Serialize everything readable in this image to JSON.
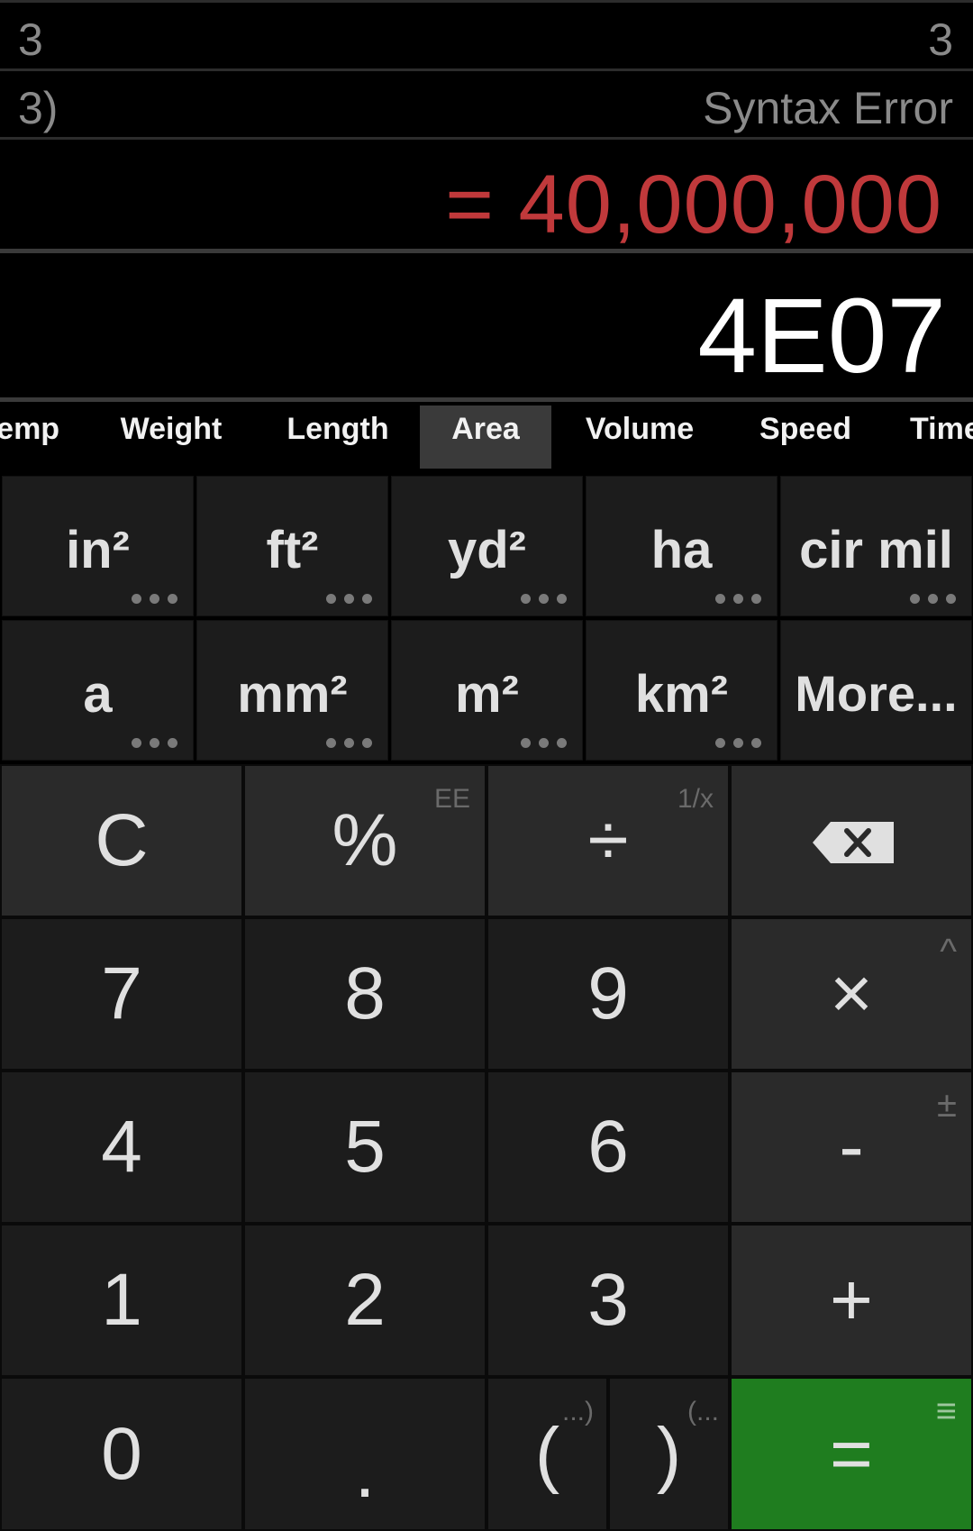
{
  "history": [
    {
      "expression": "3",
      "result": "3"
    },
    {
      "expression": "3)",
      "result": "Syntax Error"
    }
  ],
  "result_display": "= 40,000,000",
  "expression_display": "4E07",
  "colors": {
    "result": "#c0393b",
    "equals_key": "#1f7d1f",
    "active_tab": "#3a3a3a"
  },
  "tabs": [
    {
      "label": "Temp",
      "active": false
    },
    {
      "label": "Weight",
      "active": false
    },
    {
      "label": "Length",
      "active": false
    },
    {
      "label": "Area",
      "active": true
    },
    {
      "label": "Volume",
      "active": false
    },
    {
      "label": "Speed",
      "active": false
    },
    {
      "label": "Time",
      "active": false
    }
  ],
  "units": [
    {
      "label": "in²",
      "more": true
    },
    {
      "label": "ft²",
      "more": true
    },
    {
      "label": "yd²",
      "more": true
    },
    {
      "label": "ha",
      "more": true
    },
    {
      "label": "cir mil",
      "more": true
    },
    {
      "label": "a",
      "more": true
    },
    {
      "label": "mm²",
      "more": true
    },
    {
      "label": "m²",
      "more": true
    },
    {
      "label": "km²",
      "more": true
    },
    {
      "label": "More...",
      "more": false
    }
  ],
  "keys": {
    "clear": "C",
    "percent": "%",
    "percent_alt": "EE",
    "divide": "÷",
    "divide_alt": "1/x",
    "backspace_icon": "backspace-icon",
    "seven": "7",
    "eight": "8",
    "nine": "9",
    "multiply": "×",
    "multiply_alt": "^",
    "four": "4",
    "five": "5",
    "six": "6",
    "minus": "-",
    "minus_alt": "±",
    "one": "1",
    "two": "2",
    "three": "3",
    "plus": "+",
    "zero": "0",
    "dot": ".",
    "open_paren": "(",
    "open_paren_alt": "...)",
    "close_paren": ")",
    "close_paren_alt": "(...",
    "equals": "=",
    "equals_alt": "≡"
  }
}
